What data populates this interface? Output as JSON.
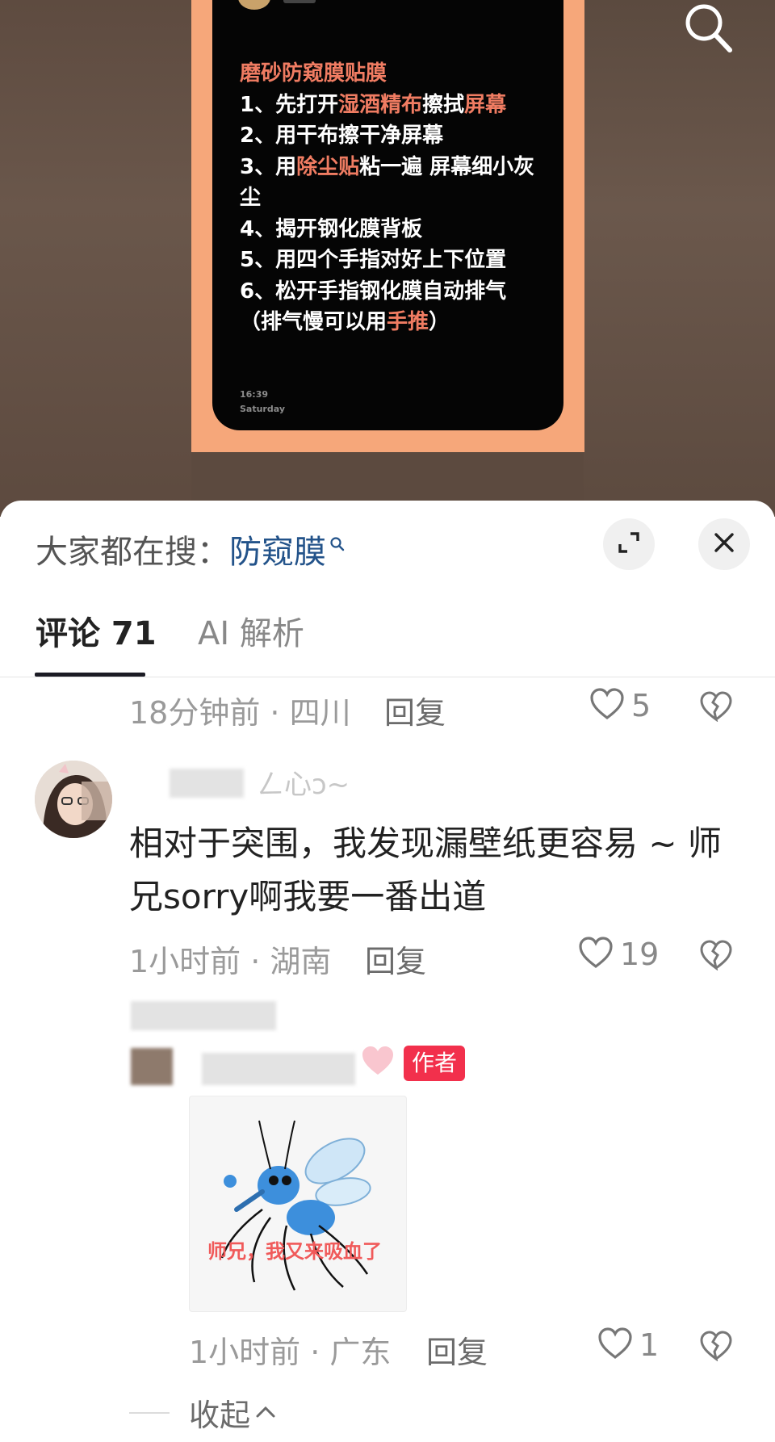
{
  "video": {
    "memo_title": "磨砂防窥膜贴膜",
    "memo_lines": [
      {
        "parts": [
          "1、先打开",
          "湿酒精布",
          "擦拭",
          "屏幕"
        ]
      },
      {
        "parts": [
          "2、用干布擦干净屏幕"
        ]
      },
      {
        "parts": [
          "3、用",
          "除尘贴",
          "粘一遍 屏幕细小灰尘"
        ]
      },
      {
        "parts": [
          "4、揭开钢化膜背板"
        ]
      },
      {
        "parts": [
          "5、用四个手指对好上下位置"
        ]
      },
      {
        "parts": [
          "6、松开手指钢化膜自动排气（排气慢可以用",
          "手推",
          "）"
        ]
      }
    ],
    "memo_time": "16:39",
    "memo_day": "Saturday"
  },
  "sheet": {
    "search_prefix": "大家都在搜：",
    "search_keyword": "防窥膜",
    "tabs": [
      {
        "label": "评论 71",
        "active": true
      },
      {
        "label": "AI 解析",
        "active": false
      }
    ]
  },
  "comments": [
    {
      "time_location": "18分钟前 · 四川",
      "reply_label": "回复",
      "likes": "5"
    },
    {
      "username_suffix": "ㄥ心ɔ~",
      "text": "相对于突围，我发现漏壁纸更容易 ~ 师兄sorry啊我要一番出道",
      "time_location": "1小时前 · 湖南",
      "reply_label": "回复",
      "likes": "19"
    }
  ],
  "reply": {
    "author_badge": "作者",
    "sticker_text": "师兄，我又来吸血了",
    "time_location": "1小时前 · 广东",
    "reply_label": "回复",
    "likes": "1"
  },
  "collapse_label": "收起",
  "colors": {
    "accent": "#f2304c",
    "keyword": "#23538a",
    "memo_highlight": "#f07c62",
    "frame": "#f6a77a"
  }
}
